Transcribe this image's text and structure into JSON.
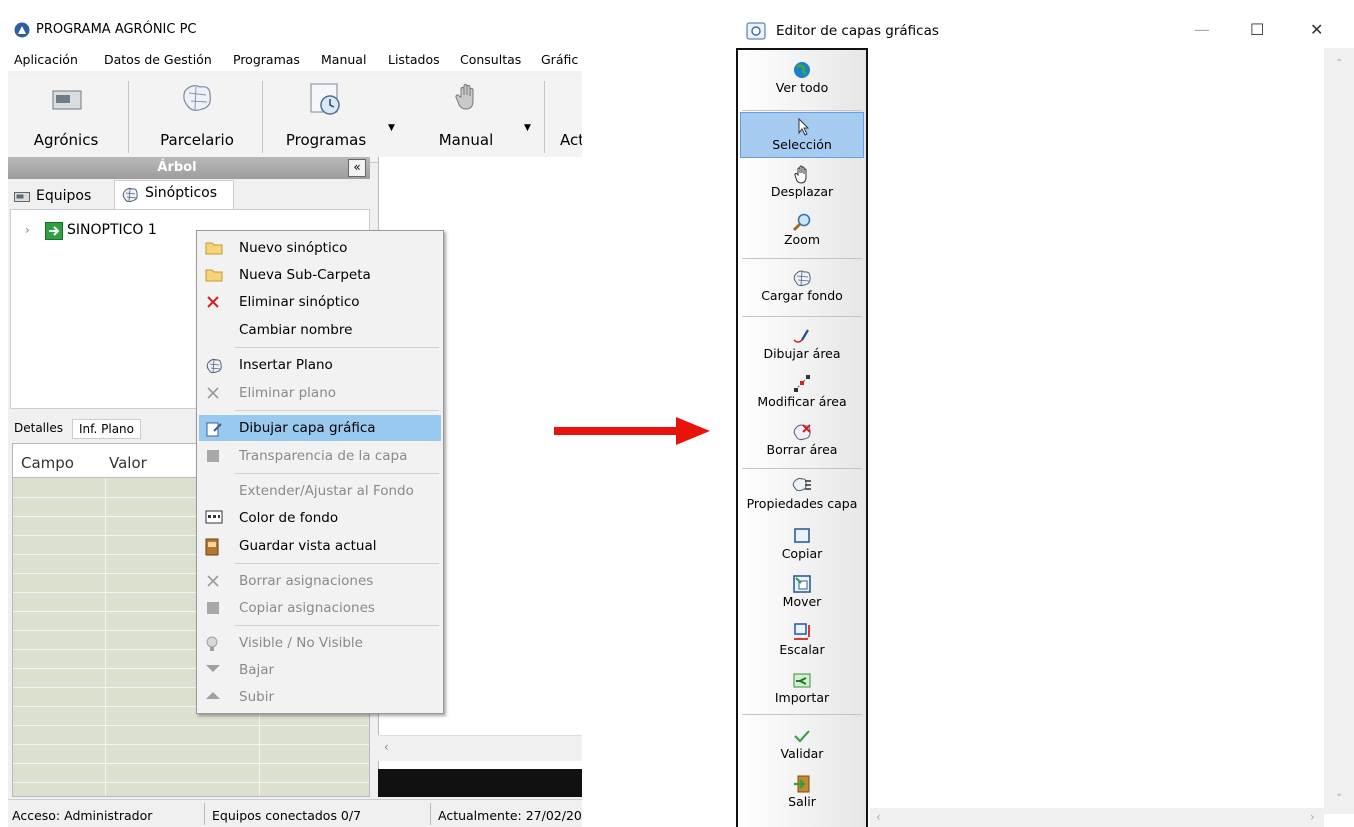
{
  "left_window": {
    "title": "PROGRAMA AGRÓNIC PC",
    "menu": [
      "Aplicación",
      "Datos de Gestión",
      "Programas",
      "Manual",
      "Listados",
      "Consultas",
      "Gráfic"
    ],
    "toolbar": {
      "agronics": "Agrónics",
      "parcelario": "Parcelario",
      "programas": "Programas",
      "manual": "Manual",
      "act": "Act"
    },
    "arbol": {
      "title": "Árbol",
      "collapse": "«",
      "tab_equipos": "Equipos",
      "tab_sinopticos": "Sinópticos",
      "tree_item": "SINOPTICO 1"
    },
    "details": {
      "tab_detalles": "Detalles",
      "tab_inf_plano": "Inf. Plano",
      "col_campo": "Campo",
      "col_valor": "Valor"
    },
    "status": {
      "acceso": "Acceso: Administrador",
      "equipos": "Equipos conectados 0/7",
      "actualmente": "Actualmente: 27/02/20"
    }
  },
  "context_menu": [
    {
      "label": "Nuevo sinóptico",
      "icon": "folder-icon",
      "enabled": true
    },
    {
      "label": "Nueva Sub-Carpeta",
      "icon": "folder-icon",
      "enabled": true
    },
    {
      "label": "Eliminar sinóptico",
      "icon": "red-x-icon",
      "enabled": true
    },
    {
      "label": "Cambiar nombre",
      "icon": "",
      "enabled": true
    },
    {
      "label": "Insertar Plano",
      "icon": "map-icon",
      "enabled": true
    },
    {
      "label": "Eliminar plano",
      "icon": "gray-x-icon",
      "enabled": false
    },
    {
      "label": "Dibujar capa gráfica",
      "icon": "draw-layer-icon",
      "enabled": true,
      "highlighted": true
    },
    {
      "label": "Transparencia de la capa",
      "icon": "layer-icon",
      "enabled": false
    },
    {
      "label": "Extender/Ajustar al Fondo",
      "icon": "",
      "enabled": false
    },
    {
      "label": "Color de fondo",
      "icon": "color-icon",
      "enabled": true
    },
    {
      "label": "Guardar vista actual",
      "icon": "save-view-icon",
      "enabled": true
    },
    {
      "label": "Borrar asignaciones",
      "icon": "gray-x-icon",
      "enabled": false
    },
    {
      "label": "Copiar asignaciones",
      "icon": "layer-icon",
      "enabled": false
    },
    {
      "label": "Visible / No Visible",
      "icon": "bulb-icon",
      "enabled": false
    },
    {
      "label": "Bajar",
      "icon": "down-arrow-icon",
      "enabled": false
    },
    {
      "label": "Subir",
      "icon": "up-arrow-icon",
      "enabled": false
    }
  ],
  "editor": {
    "title": "Editor de capas gráficas",
    "window_controls": {
      "minimize": "—",
      "maximize": "☐",
      "close": "✕"
    },
    "tools": [
      {
        "label": "Ver todo",
        "icon": "globe-icon"
      },
      {
        "label": "Selección",
        "icon": "cursor-icon",
        "selected": true
      },
      {
        "label": "Desplazar",
        "icon": "hand-icon"
      },
      {
        "label": "Zoom",
        "icon": "zoom-icon"
      },
      {
        "label": "Cargar fondo",
        "icon": "map-icon"
      },
      {
        "label": "Dibujar área",
        "icon": "pen-icon"
      },
      {
        "label": "Modificar área",
        "icon": "modify-area-icon"
      },
      {
        "label": "Borrar área",
        "icon": "erase-area-icon"
      },
      {
        "label": "Propiedades capa",
        "icon": "layer-properties-icon"
      },
      {
        "label": "Copiar",
        "icon": "copy-icon"
      },
      {
        "label": "Mover",
        "icon": "move-icon"
      },
      {
        "label": "Escalar",
        "icon": "scale-icon"
      },
      {
        "label": "Importar",
        "icon": "import-icon"
      },
      {
        "label": "Validar",
        "icon": "check-icon"
      },
      {
        "label": "Salir",
        "icon": "exit-icon"
      }
    ]
  },
  "colors": {
    "highlight": "#99c9ef",
    "grid": "#dbe0cf",
    "arrow": "#e8140c"
  }
}
